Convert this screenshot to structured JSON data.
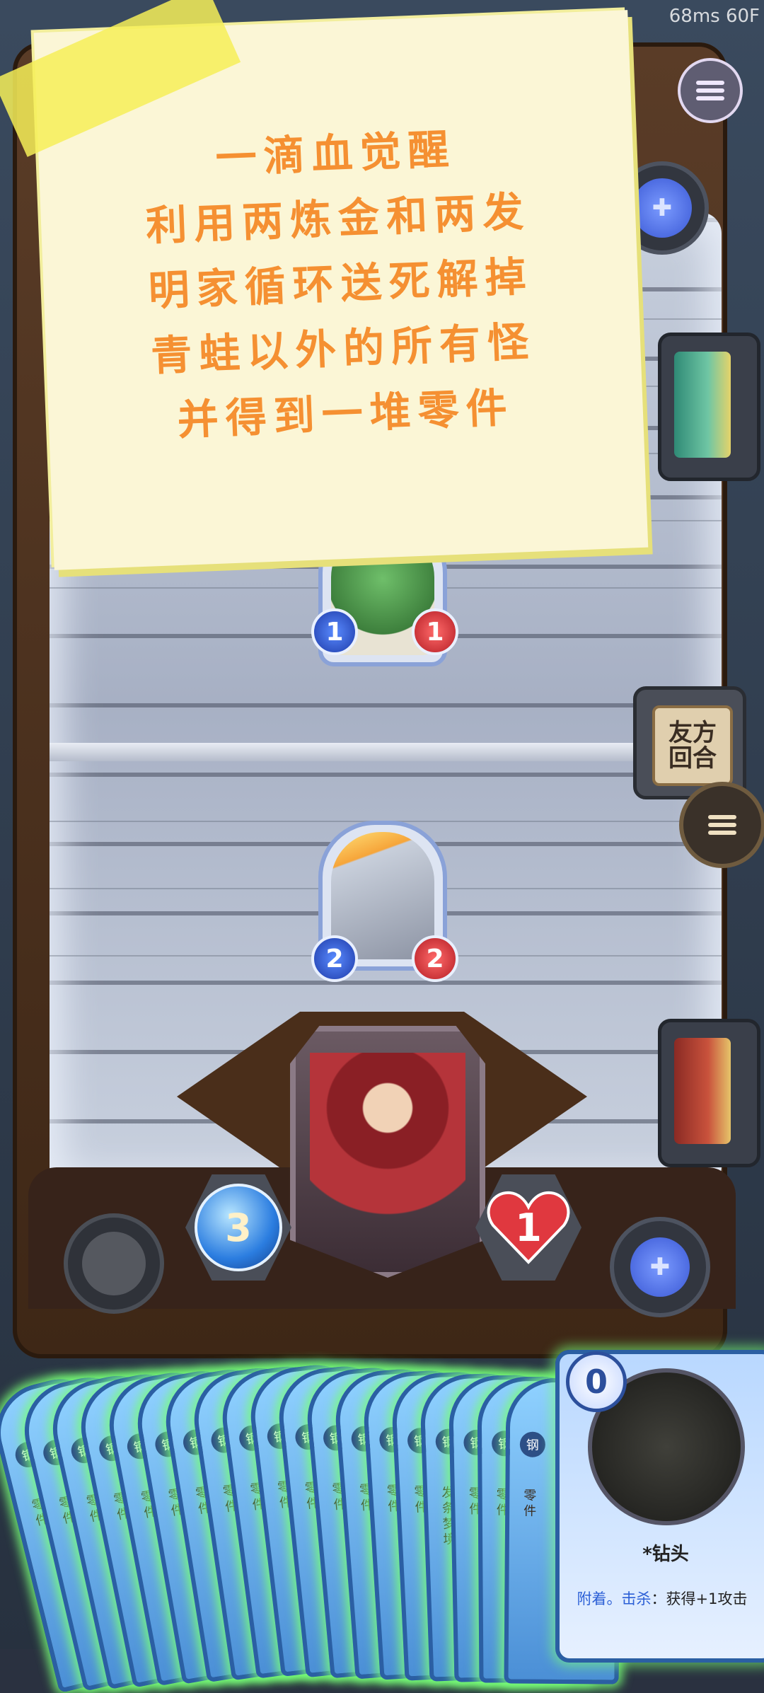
{
  "hud": {
    "fps": "68ms 60F"
  },
  "note": {
    "lines": [
      "一滴血觉醒",
      "利用两炼金和两发",
      "明家循环送死解掉",
      "青蛙以外的所有怪",
      "并得到一堆零件"
    ]
  },
  "buttons": {
    "log": "友方\n回合"
  },
  "enemy_minion": {
    "name": "frog",
    "attack": "1",
    "health": "1"
  },
  "player_minion": {
    "name": "cannon",
    "attack": "2",
    "health": "2"
  },
  "hero": {
    "mana": "3",
    "health": "1"
  },
  "hand": {
    "card_type": "钢",
    "card_label": "零件",
    "special_label": "发条梦境",
    "count": 19,
    "featured": {
      "cost": "0",
      "type": "钢",
      "name": "*钻头",
      "desc_keyword": "附着。击杀",
      "desc_rest": "：获得+1攻击"
    }
  },
  "icons": {
    "menu": "hamburger-icon",
    "tomb": "tombstone-icon",
    "deck": "deck-icon",
    "power": "hero-power-icon"
  }
}
